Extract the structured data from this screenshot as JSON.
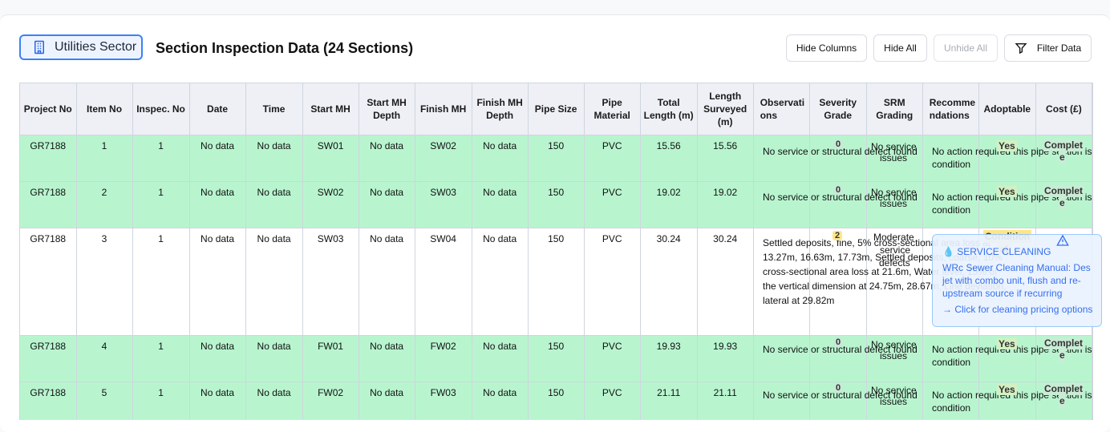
{
  "toolbar": {
    "sector_label": "Utilities Sector",
    "title": "Section Inspection Data (24 Sections)",
    "hide_columns": "Hide Columns",
    "hide_all": "Hide All",
    "unhide_all": "Unhide All",
    "filter_data": "Filter Data"
  },
  "columns": [
    "Project No",
    "Item No",
    "Inspec. No",
    "Date",
    "Time",
    "Start MH",
    "Start MH Depth",
    "Finish MH",
    "Finish MH Depth",
    "Pipe Size",
    "Pipe Material",
    "Total Length (m)",
    "Length Surveyed (m)",
    "Observations",
    "Severity Grade",
    "SRM Grading",
    "Recommendations",
    "Adoptable",
    "Cost (£)"
  ],
  "rows": [
    {
      "project": "GR7188",
      "item": "1",
      "inspec": "1",
      "date": "No data",
      "time": "No data",
      "start_mh": "SW01",
      "start_depth": "No data",
      "finish_mh": "SW02",
      "finish_depth": "No data",
      "pipe_size": "150",
      "material": "PVC",
      "total_length": "15.56",
      "surveyed": "15.56",
      "observation": "No service or structural defect found",
      "severity": "0",
      "srm_1": "No service",
      "srm_2": "issues",
      "rec_1": "No action required this pipe section is",
      "rec_2": "condition",
      "adoptable": "Yes",
      "cost_1": "Complet",
      "cost_2": "e"
    },
    {
      "project": "GR7188",
      "item": "2",
      "inspec": "1",
      "date": "No data",
      "time": "No data",
      "start_mh": "SW02",
      "start_depth": "No data",
      "finish_mh": "SW03",
      "finish_depth": "No data",
      "pipe_size": "150",
      "material": "PVC",
      "total_length": "19.02",
      "surveyed": "19.02",
      "observation": "No service or structural defect found",
      "severity": "0",
      "srm_1": "No service",
      "srm_2": "issues",
      "rec_1": "No action required this pipe section is",
      "rec_2": "condition",
      "adoptable": "Yes",
      "cost_1": "Complet",
      "cost_2": "e"
    },
    {
      "project": "GR7188",
      "item": "3",
      "inspec": "1",
      "date": "No data",
      "time": "No data",
      "start_mh": "SW03",
      "start_depth": "No data",
      "finish_mh": "SW04",
      "finish_depth": "No data",
      "pipe_size": "150",
      "material": "PVC",
      "total_length": "30.24",
      "surveyed": "30.24",
      "observation_lines": [
        "Settled deposits, fine, 5% cross-sectional area loss at",
        "13.27m, 16.63m, 17.73m, Settled deposits, coarse, 10%",
        "cross-sectional area loss at 21.6m, Water level, 15% of",
        "the vertical dimension at 24.75m, 28.67m, Line deviation,",
        "lateral at 29.82m"
      ],
      "severity": "2",
      "srm_1": "Moderate",
      "srm_2": "service",
      "srm_3": "defects",
      "adoptable_1": "Condition",
      "adoptable_2": "al"
    },
    {
      "project": "GR7188",
      "item": "4",
      "inspec": "1",
      "date": "No data",
      "time": "No data",
      "start_mh": "FW01",
      "start_depth": "No data",
      "finish_mh": "FW02",
      "finish_depth": "No data",
      "pipe_size": "150",
      "material": "PVC",
      "total_length": "19.93",
      "surveyed": "19.93",
      "observation": "No service or structural defect found",
      "severity": "0",
      "srm_1": "No service",
      "srm_2": "issues",
      "rec_1": "No action required this pipe section is",
      "rec_2": "condition",
      "adoptable": "Yes",
      "cost_1": "Complet",
      "cost_2": "e"
    },
    {
      "project": "GR7188",
      "item": "5",
      "inspec": "1",
      "date": "No data",
      "time": "No data",
      "start_mh": "FW02",
      "start_depth": "No data",
      "finish_mh": "FW03",
      "finish_depth": "No data",
      "pipe_size": "150",
      "material": "PVC",
      "total_length": "21.11",
      "surveyed": "21.11",
      "observation": "No service or structural defect found",
      "severity": "0",
      "srm_1": "No service",
      "srm_2": "issues",
      "rec_1": "No action required this pipe section is",
      "rec_2": "condition",
      "adoptable": "Yes",
      "cost_1": "Complet",
      "cost_2": "e"
    }
  ],
  "service_card": {
    "heading": "SERVICE CLEANING",
    "line1": "WRc Sewer Cleaning Manual: Des",
    "line2": "jet with combo unit, flush and re-",
    "line3": "upstream source if recurring",
    "link": "→ Click for cleaning pricing options"
  }
}
